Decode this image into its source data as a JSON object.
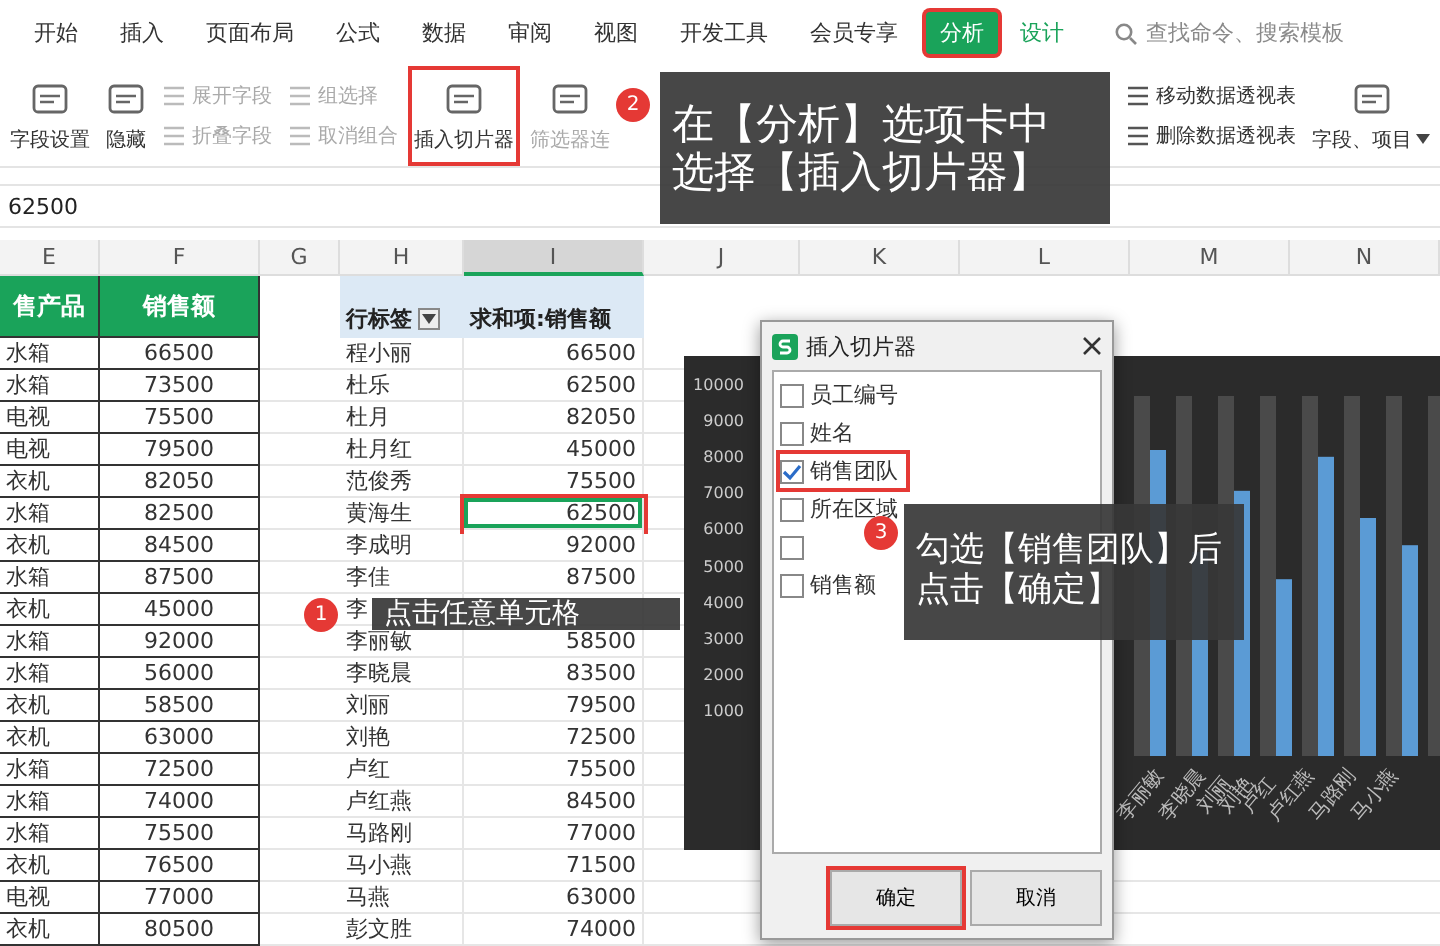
{
  "tabs": [
    {
      "label": "开始",
      "selected": false,
      "contextual": false,
      "highlighted": false
    },
    {
      "label": "插入",
      "selected": false,
      "contextual": false,
      "highlighted": false
    },
    {
      "label": "页面布局",
      "selected": false,
      "contextual": false,
      "highlighted": false
    },
    {
      "label": "公式",
      "selected": false,
      "contextual": false,
      "highlighted": false
    },
    {
      "label": "数据",
      "selected": false,
      "contextual": false,
      "highlighted": false
    },
    {
      "label": "审阅",
      "selected": false,
      "contextual": false,
      "highlighted": false
    },
    {
      "label": "视图",
      "selected": false,
      "contextual": false,
      "highlighted": false
    },
    {
      "label": "开发工具",
      "selected": false,
      "contextual": false,
      "highlighted": false
    },
    {
      "label": "会员专享",
      "selected": false,
      "contextual": false,
      "highlighted": false
    },
    {
      "label": "分析",
      "selected": true,
      "contextual": true,
      "highlighted": true
    },
    {
      "label": "设计",
      "selected": false,
      "contextual": true,
      "highlighted": false
    }
  ],
  "search": {
    "placeholder": "查找命令、搜索模板"
  },
  "ribbon": [
    {
      "kind": "large",
      "label": "字段设置",
      "disabled": false,
      "highlighted": false,
      "dropdown": false
    },
    {
      "kind": "large",
      "label": "隐藏",
      "disabled": false,
      "highlighted": false,
      "dropdown": false
    },
    {
      "kind": "pair",
      "items": [
        {
          "label": "展开字段",
          "disabled": true
        },
        {
          "label": "折叠字段",
          "disabled": true
        }
      ]
    },
    {
      "kind": "pair",
      "items": [
        {
          "label": "组选择",
          "disabled": true
        },
        {
          "label": "取消组合",
          "disabled": true
        }
      ]
    },
    {
      "kind": "large",
      "label": "插入切片器",
      "disabled": false,
      "highlighted": true,
      "dropdown": false
    },
    {
      "kind": "large",
      "label": "筛选器连",
      "disabled": true,
      "highlighted": false,
      "dropdown": false
    },
    {
      "kind": "pair",
      "items": [
        {
          "label": "移动数据透视表",
          "disabled": false
        },
        {
          "label": "删除数据透视表",
          "disabled": false
        }
      ]
    },
    {
      "kind": "large",
      "label": "字段、项目",
      "disabled": false,
      "highlighted": false,
      "dropdown": true
    }
  ],
  "formula_bar": {
    "value": "62500"
  },
  "columns": [
    "E",
    "F",
    "G",
    "H",
    "I",
    "J",
    "K",
    "L",
    "M",
    "N"
  ],
  "source_table": {
    "headers": [
      "售产品",
      "销售额"
    ],
    "rows": [
      [
        "水箱",
        "66500"
      ],
      [
        "水箱",
        "73500"
      ],
      [
        "电视",
        "75500"
      ],
      [
        "电视",
        "79500"
      ],
      [
        "衣机",
        "82050"
      ],
      [
        "水箱",
        "82500"
      ],
      [
        "衣机",
        "84500"
      ],
      [
        "水箱",
        "87500"
      ],
      [
        "衣机",
        "45000"
      ],
      [
        "水箱",
        "92000"
      ],
      [
        "水箱",
        "56000"
      ],
      [
        "衣机",
        "58500"
      ],
      [
        "衣机",
        "63000"
      ],
      [
        "水箱",
        "72500"
      ],
      [
        "水箱",
        "74000"
      ],
      [
        "水箱",
        "75500"
      ],
      [
        "衣机",
        "76500"
      ],
      [
        "电视",
        "77000"
      ],
      [
        "衣机",
        "80500"
      ]
    ]
  },
  "pivot": {
    "row_label": "行标签",
    "value_label": "求和项:销售额",
    "rows": [
      {
        "name": "程小丽",
        "value": "66500",
        "highlighted": false
      },
      {
        "name": "杜乐",
        "value": "62500",
        "highlighted": false
      },
      {
        "name": "杜月",
        "value": "82050",
        "highlighted": false
      },
      {
        "name": "杜月红",
        "value": "45000",
        "highlighted": false
      },
      {
        "name": "范俊秀",
        "value": "75500",
        "highlighted": false
      },
      {
        "name": "黄海生",
        "value": "62500",
        "highlighted": true
      },
      {
        "name": "李成明",
        "value": "92000",
        "highlighted": false
      },
      {
        "name": "李佳",
        "value": "87500",
        "highlighted": false
      },
      {
        "name": "李",
        "highlighted": false
      },
      {
        "name": "李丽敏",
        "value": "58500",
        "highlighted": false
      },
      {
        "name": "李晓晨",
        "value": "83500",
        "highlighted": false
      },
      {
        "name": "刘丽",
        "value": "79500",
        "highlighted": false
      },
      {
        "name": "刘艳",
        "value": "72500",
        "highlighted": false
      },
      {
        "name": "卢红",
        "value": "75500",
        "highlighted": false
      },
      {
        "name": "卢红燕",
        "value": "84500",
        "highlighted": false
      },
      {
        "name": "马路刚",
        "value": "77000",
        "highlighted": false
      },
      {
        "name": "马小燕",
        "value": "71500",
        "highlighted": false
      },
      {
        "name": "马燕",
        "value": "63000",
        "highlighted": false
      },
      {
        "name": "彭文胜",
        "value": "74000",
        "highlighted": false
      }
    ]
  },
  "chart": {
    "y_ticks": [
      "10000",
      "9000",
      "8000",
      "7000",
      "6000",
      "5000",
      "4000",
      "3000",
      "2000",
      "1000"
    ],
    "x_labels": [
      "李丽敏",
      "李晓晨",
      "刘丽",
      "刘艳",
      "卢红",
      "卢红燕",
      "马路刚",
      "马小燕"
    ]
  },
  "dialog": {
    "title": "插入切片器",
    "fields": [
      {
        "label": "员工编号",
        "checked": false,
        "highlighted": false
      },
      {
        "label": "姓名",
        "checked": false,
        "highlighted": false
      },
      {
        "label": "销售团队",
        "checked": true,
        "highlighted": true
      },
      {
        "label": "所在区域",
        "checked": false,
        "highlighted": false
      },
      {
        "checked": false,
        "highlighted": false
      },
      {
        "label": "销售额",
        "checked": false,
        "highlighted": false
      }
    ],
    "buttons": [
      {
        "label": "确定",
        "highlighted": true
      },
      {
        "label": "取消",
        "highlighted": false
      }
    ]
  },
  "callouts": [
    {
      "number": "2",
      "lines": [
        "在【分析】选项卡中",
        "选择【插入切片器】"
      ]
    },
    {
      "number": "1",
      "lines": [
        "点击任意单元格"
      ]
    },
    {
      "number": "3",
      "lines": [
        "勾选【销售团队】后",
        "点击【确定】"
      ]
    }
  ]
}
